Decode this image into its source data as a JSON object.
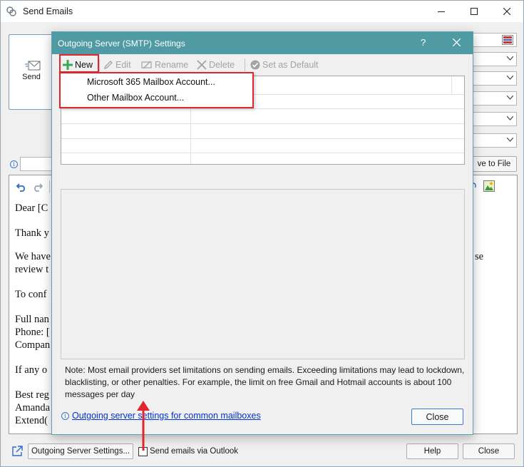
{
  "main_window": {
    "title": "Send Emails",
    "send_label": "Send",
    "save_to_file_label": "ve to File",
    "editor_lines": [
      "Dear [C",
      "Thank y",
      "We have",
      "review t",
      "To conf",
      "Full nan",
      "Phone: [",
      "Compan",
      "If any o",
      "Best reg",
      "Amanda",
      "Extend("
    ],
    "editor_right_fragment": "se",
    "outgoing_server_settings_button": "Outgoing Server Settings...",
    "send_via_outlook_label": "Send emails via Outlook",
    "send_via_outlook_checked": false,
    "help_button": "Help",
    "close_button": "Close"
  },
  "dialog": {
    "title": "Outgoing Server (SMTP) Settings",
    "help_glyph": "?",
    "toolbar": {
      "new": "New",
      "edit": "Edit",
      "rename": "Rename",
      "delete": "Delete",
      "set_default": "Set as Default"
    },
    "new_menu": [
      "Microsoft 365 Mailbox Account...",
      "Other Mailbox Account..."
    ],
    "note": "Note: Most email providers set limitations on sending emails. Exceeding limitations may lead to lockdown, blacklisting, or other penalties. For example, the limit on free Gmail and Hotmail accounts is about 100 messages per day",
    "link_text": "Outgoing server settings for common mailboxes",
    "close_button": "Close"
  },
  "colors": {
    "dialog_titlebar": "#4f9aa3",
    "highlight_red": "#e0262d",
    "link_blue": "#0033cc",
    "new_plus_green": "#3aa655"
  }
}
